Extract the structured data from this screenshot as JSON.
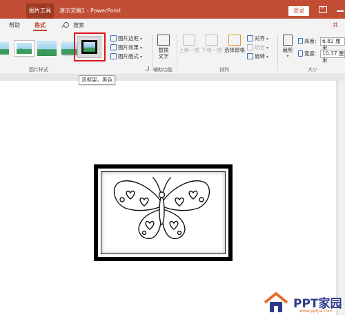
{
  "titlebar": {
    "context_tool": "图片工具",
    "doc_title": "演示文稿1 - PowerPoint",
    "login_label": "登录",
    "bg_color": "#c14d34"
  },
  "tabs": {
    "help": "帮助",
    "format": "格式",
    "search": "搜索",
    "share": "共"
  },
  "ribbon": {
    "picture_styles_label": "图片样式",
    "picture_border": "图片边框",
    "picture_effects": "图片效果",
    "picture_layout": "图片版式",
    "alt_text_line1": "替换",
    "alt_text_line2": "文字",
    "accessibility_label": "辅助功能",
    "bring_forward": "上移一层",
    "send_backward": "下移一层",
    "selection_pane": "选择窗格",
    "align": "对齐",
    "group": "组合",
    "rotate": "旋转",
    "arrange_label": "排列",
    "crop": "裁剪",
    "height_label": "高度:",
    "height_value": "6.82 厘米",
    "width_label": "宽度:",
    "width_value": "10.37 厘米",
    "size_label": "大小"
  },
  "tooltip": {
    "text": "双框架，黑色"
  },
  "watermark": {
    "text": "PPT家园",
    "url": "www.pptjia.com"
  }
}
